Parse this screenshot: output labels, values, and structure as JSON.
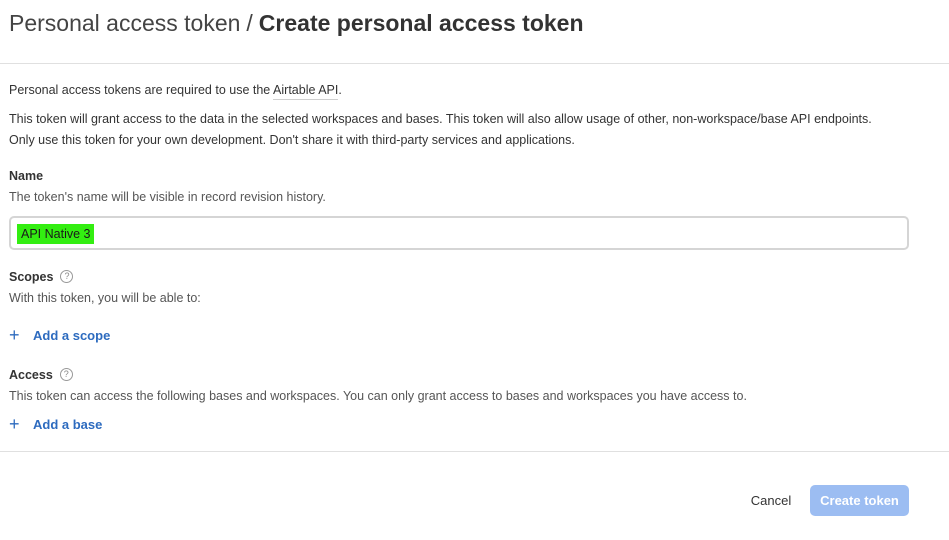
{
  "header": {
    "breadcrumb_parent": "Personal access token",
    "separator": "/",
    "title": "Create personal access token"
  },
  "intro": {
    "line1_prefix": "Personal access tokens are required to use the ",
    "line1_link": "Airtable API",
    "line1_suffix": ".",
    "line2": "This token will grant access to the data in the selected workspaces and bases. This token will also allow usage of other, non-workspace/base API endpoints.",
    "line3": "Only use this token for your own development. Don't share it with third-party services and applications."
  },
  "name_section": {
    "label": "Name",
    "help": "The token's name will be visible in record revision history.",
    "value": "API Native 3"
  },
  "scopes_section": {
    "label": "Scopes",
    "help_icon": "?",
    "help": "With this token, you will be able to:",
    "add_label": "Add a scope"
  },
  "access_section": {
    "label": "Access",
    "help_icon": "?",
    "help": "This token can access the following bases and workspaces. You can only grant access to bases and workspaces you have access to.",
    "add_label": "Add a base"
  },
  "footer": {
    "cancel_label": "Cancel",
    "create_label": "Create token"
  },
  "colors": {
    "accent": "#2d6bbf",
    "button_disabled": "#9cbdf2",
    "highlight": "#33ee11"
  },
  "icons": {
    "help": "question-circle-icon",
    "add": "plus-icon"
  }
}
